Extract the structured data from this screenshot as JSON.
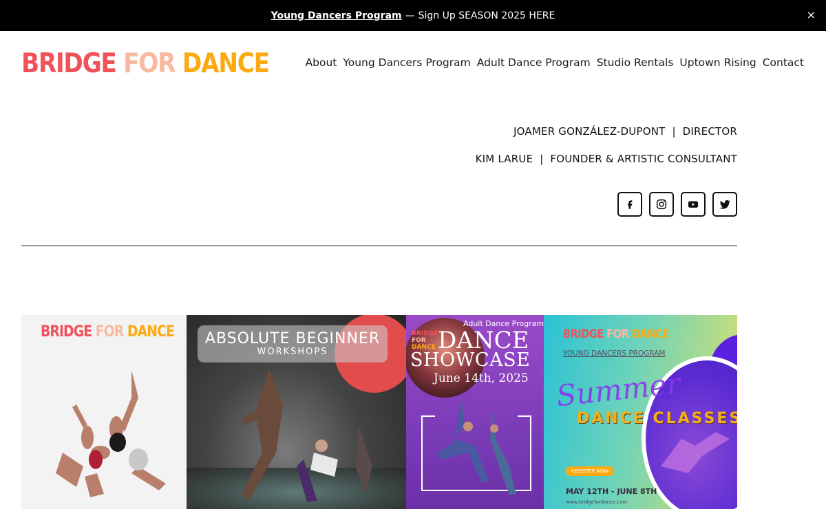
{
  "announcement": {
    "link_text": "Young Dancers Program",
    "separator": "—",
    "text": "Sign Up SEASON 2025 HERE",
    "close": "×"
  },
  "logo": {
    "part1": "BRIDGE ",
    "part2": "FOR ",
    "part3": "DANCE"
  },
  "nav": {
    "items": [
      "About",
      "Young Dancers Program",
      "Adult Dance Program",
      "Studio Rentals",
      "Uptown Rising",
      "Contact"
    ]
  },
  "credits": [
    {
      "name": "JOAMER GONZÁLEZ-DUPONT",
      "sep": "|",
      "role": "DIRECTOR"
    },
    {
      "name": "KIM LARUE",
      "sep": "|",
      "role": "FOUNDER & ARTISTIC CONSULTANT"
    }
  ],
  "socials": [
    "facebook-icon",
    "instagram-icon",
    "youtube-icon",
    "twitter-icon"
  ],
  "gallery": {
    "tile1": {
      "brand1": "BRIDGE ",
      "brand2": "FOR ",
      "brand3": "DANCE"
    },
    "tile2": {
      "title": "ABSOLUTE BEGINNER",
      "subtitle": "WORKSHOPS"
    },
    "tile3": {
      "tag": "Adult Dance Program",
      "brand1": "BRIDGE",
      "brand2": "FOR",
      "brand3": "DANCE",
      "title1": "DANCE",
      "title2": "SHOWCASE",
      "date": "June 14th, 2025"
    },
    "tile4": {
      "brand1": "BRIDGE ",
      "brand2": "FOR ",
      "brand3": "DANCE",
      "subtitle": "YOUNG DANCERS PROGRAM",
      "script": "Summer",
      "classes": "DANCE CLASSES",
      "register": "REGISTER NOW",
      "dates": "MAY 12TH - JUNE 8TH",
      "url": "www.bridgefordance.com"
    }
  }
}
